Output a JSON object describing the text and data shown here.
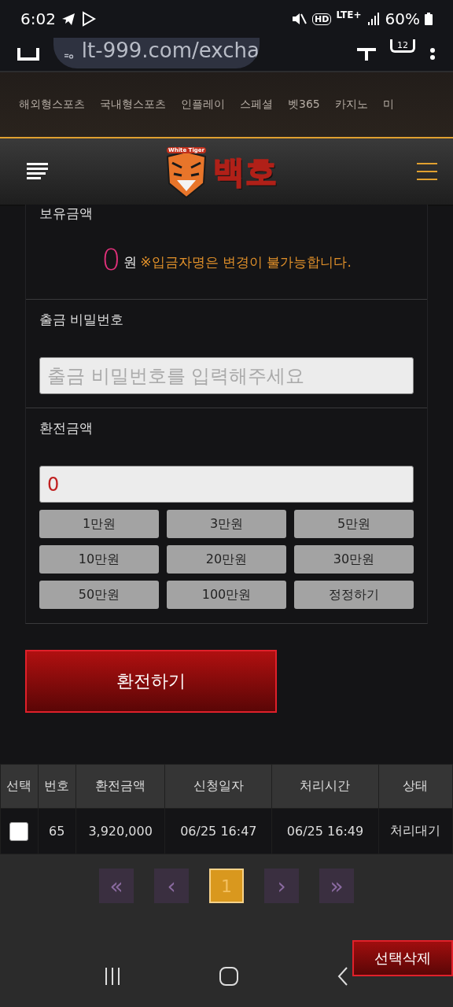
{
  "status_bar": {
    "time": "6:02",
    "hd": "HD",
    "network": "LTE+",
    "battery": "60%"
  },
  "browser": {
    "url": "lt-999.com/excha",
    "tab_count": "12"
  },
  "category_nav": [
    "해외형스포츠",
    "국내형스포츠",
    "인플레이",
    "스페셜",
    "벳365",
    "카지노",
    "미"
  ],
  "header": {
    "logo_badge": "White Tiger",
    "brand": "백호"
  },
  "balance": {
    "label": "보유금액",
    "amount": "0",
    "unit": "원",
    "notice": "※입금자명은 변경이 불가능합니다."
  },
  "password": {
    "label": "출금 비밀번호",
    "placeholder": "출금 비밀번호를 입력해주세요"
  },
  "exchange": {
    "label": "환전금액",
    "value": "0",
    "quick_buttons": [
      "1만원",
      "3만원",
      "5만원",
      "10만원",
      "20만원",
      "30만원",
      "50만원",
      "100만원",
      "정정하기"
    ]
  },
  "submit_button": "환전하기",
  "table": {
    "columns": [
      "선택",
      "번호",
      "환전금액",
      "신청일자",
      "처리시간",
      "상태"
    ],
    "rows": [
      {
        "checked": false,
        "cells": [
          "",
          "65",
          "3,920,000",
          "06/25 16:47",
          "06/25 16:49",
          "처리대기"
        ]
      }
    ]
  },
  "pagination": [
    {
      "label": "«",
      "kind": "arrow",
      "selected": false
    },
    {
      "label": "‹",
      "kind": "arrow",
      "selected": false
    },
    {
      "label": "1",
      "kind": "page",
      "selected": true
    },
    {
      "label": "›",
      "kind": "arrow",
      "selected": false
    },
    {
      "label": "»",
      "kind": "arrow",
      "selected": false
    }
  ],
  "delete_button": "선택삭제"
}
